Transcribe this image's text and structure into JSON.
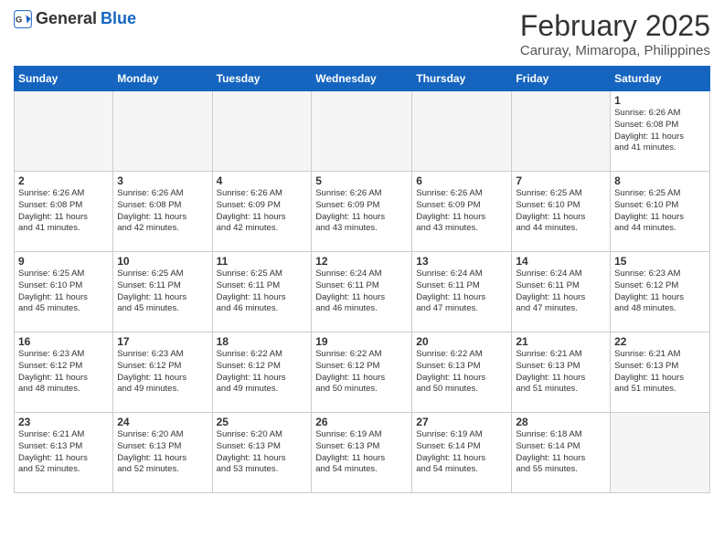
{
  "header": {
    "logo_general": "General",
    "logo_blue": "Blue",
    "month_title": "February 2025",
    "location": "Caruray, Mimaropa, Philippines"
  },
  "weekdays": [
    "Sunday",
    "Monday",
    "Tuesday",
    "Wednesday",
    "Thursday",
    "Friday",
    "Saturday"
  ],
  "weeks": [
    [
      {
        "day": "",
        "info": ""
      },
      {
        "day": "",
        "info": ""
      },
      {
        "day": "",
        "info": ""
      },
      {
        "day": "",
        "info": ""
      },
      {
        "day": "",
        "info": ""
      },
      {
        "day": "",
        "info": ""
      },
      {
        "day": "1",
        "info": "Sunrise: 6:26 AM\nSunset: 6:08 PM\nDaylight: 11 hours\nand 41 minutes."
      }
    ],
    [
      {
        "day": "2",
        "info": "Sunrise: 6:26 AM\nSunset: 6:08 PM\nDaylight: 11 hours\nand 41 minutes."
      },
      {
        "day": "3",
        "info": "Sunrise: 6:26 AM\nSunset: 6:08 PM\nDaylight: 11 hours\nand 42 minutes."
      },
      {
        "day": "4",
        "info": "Sunrise: 6:26 AM\nSunset: 6:09 PM\nDaylight: 11 hours\nand 42 minutes."
      },
      {
        "day": "5",
        "info": "Sunrise: 6:26 AM\nSunset: 6:09 PM\nDaylight: 11 hours\nand 43 minutes."
      },
      {
        "day": "6",
        "info": "Sunrise: 6:26 AM\nSunset: 6:09 PM\nDaylight: 11 hours\nand 43 minutes."
      },
      {
        "day": "7",
        "info": "Sunrise: 6:25 AM\nSunset: 6:10 PM\nDaylight: 11 hours\nand 44 minutes."
      },
      {
        "day": "8",
        "info": "Sunrise: 6:25 AM\nSunset: 6:10 PM\nDaylight: 11 hours\nand 44 minutes."
      }
    ],
    [
      {
        "day": "9",
        "info": "Sunrise: 6:25 AM\nSunset: 6:10 PM\nDaylight: 11 hours\nand 45 minutes."
      },
      {
        "day": "10",
        "info": "Sunrise: 6:25 AM\nSunset: 6:11 PM\nDaylight: 11 hours\nand 45 minutes."
      },
      {
        "day": "11",
        "info": "Sunrise: 6:25 AM\nSunset: 6:11 PM\nDaylight: 11 hours\nand 46 minutes."
      },
      {
        "day": "12",
        "info": "Sunrise: 6:24 AM\nSunset: 6:11 PM\nDaylight: 11 hours\nand 46 minutes."
      },
      {
        "day": "13",
        "info": "Sunrise: 6:24 AM\nSunset: 6:11 PM\nDaylight: 11 hours\nand 47 minutes."
      },
      {
        "day": "14",
        "info": "Sunrise: 6:24 AM\nSunset: 6:11 PM\nDaylight: 11 hours\nand 47 minutes."
      },
      {
        "day": "15",
        "info": "Sunrise: 6:23 AM\nSunset: 6:12 PM\nDaylight: 11 hours\nand 48 minutes."
      }
    ],
    [
      {
        "day": "16",
        "info": "Sunrise: 6:23 AM\nSunset: 6:12 PM\nDaylight: 11 hours\nand 48 minutes."
      },
      {
        "day": "17",
        "info": "Sunrise: 6:23 AM\nSunset: 6:12 PM\nDaylight: 11 hours\nand 49 minutes."
      },
      {
        "day": "18",
        "info": "Sunrise: 6:22 AM\nSunset: 6:12 PM\nDaylight: 11 hours\nand 49 minutes."
      },
      {
        "day": "19",
        "info": "Sunrise: 6:22 AM\nSunset: 6:12 PM\nDaylight: 11 hours\nand 50 minutes."
      },
      {
        "day": "20",
        "info": "Sunrise: 6:22 AM\nSunset: 6:13 PM\nDaylight: 11 hours\nand 50 minutes."
      },
      {
        "day": "21",
        "info": "Sunrise: 6:21 AM\nSunset: 6:13 PM\nDaylight: 11 hours\nand 51 minutes."
      },
      {
        "day": "22",
        "info": "Sunrise: 6:21 AM\nSunset: 6:13 PM\nDaylight: 11 hours\nand 51 minutes."
      }
    ],
    [
      {
        "day": "23",
        "info": "Sunrise: 6:21 AM\nSunset: 6:13 PM\nDaylight: 11 hours\nand 52 minutes."
      },
      {
        "day": "24",
        "info": "Sunrise: 6:20 AM\nSunset: 6:13 PM\nDaylight: 11 hours\nand 52 minutes."
      },
      {
        "day": "25",
        "info": "Sunrise: 6:20 AM\nSunset: 6:13 PM\nDaylight: 11 hours\nand 53 minutes."
      },
      {
        "day": "26",
        "info": "Sunrise: 6:19 AM\nSunset: 6:13 PM\nDaylight: 11 hours\nand 54 minutes."
      },
      {
        "day": "27",
        "info": "Sunrise: 6:19 AM\nSunset: 6:14 PM\nDaylight: 11 hours\nand 54 minutes."
      },
      {
        "day": "28",
        "info": "Sunrise: 6:18 AM\nSunset: 6:14 PM\nDaylight: 11 hours\nand 55 minutes."
      },
      {
        "day": "",
        "info": ""
      }
    ]
  ]
}
